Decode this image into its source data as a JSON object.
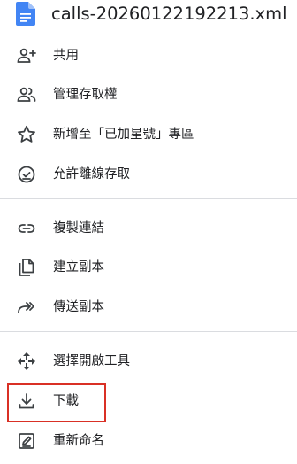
{
  "header": {
    "file_name": "calls-20260122192213.xml",
    "file_icon": "google-docs-file-icon",
    "file_icon_color": "#4285f4"
  },
  "menu": {
    "items": [
      {
        "id": "share",
        "label": "共用",
        "icon": "person-add-icon"
      },
      {
        "id": "manage-access",
        "label": "管理存取權",
        "icon": "people-icon"
      },
      {
        "id": "star",
        "label": "新增至「已加星號」專區",
        "icon": "star-outline-icon"
      },
      {
        "id": "offline",
        "label": "允許離線存取",
        "icon": "offline-check-icon"
      },
      {
        "id": "copy-link",
        "label": "複製連結",
        "icon": "link-icon"
      },
      {
        "id": "make-copy",
        "label": "建立副本",
        "icon": "copy-file-icon"
      },
      {
        "id": "send-copy",
        "label": "傳送副本",
        "icon": "send-copy-icon"
      },
      {
        "id": "open-with",
        "label": "選擇開啟工具",
        "icon": "open-with-icon"
      },
      {
        "id": "download",
        "label": "下載",
        "icon": "download-icon"
      },
      {
        "id": "rename",
        "label": "重新命名",
        "icon": "rename-icon"
      }
    ]
  },
  "colors": {
    "icon": "#3c4043",
    "text": "#202124",
    "divider": "#dadce0",
    "highlight_border": "#d93025"
  }
}
